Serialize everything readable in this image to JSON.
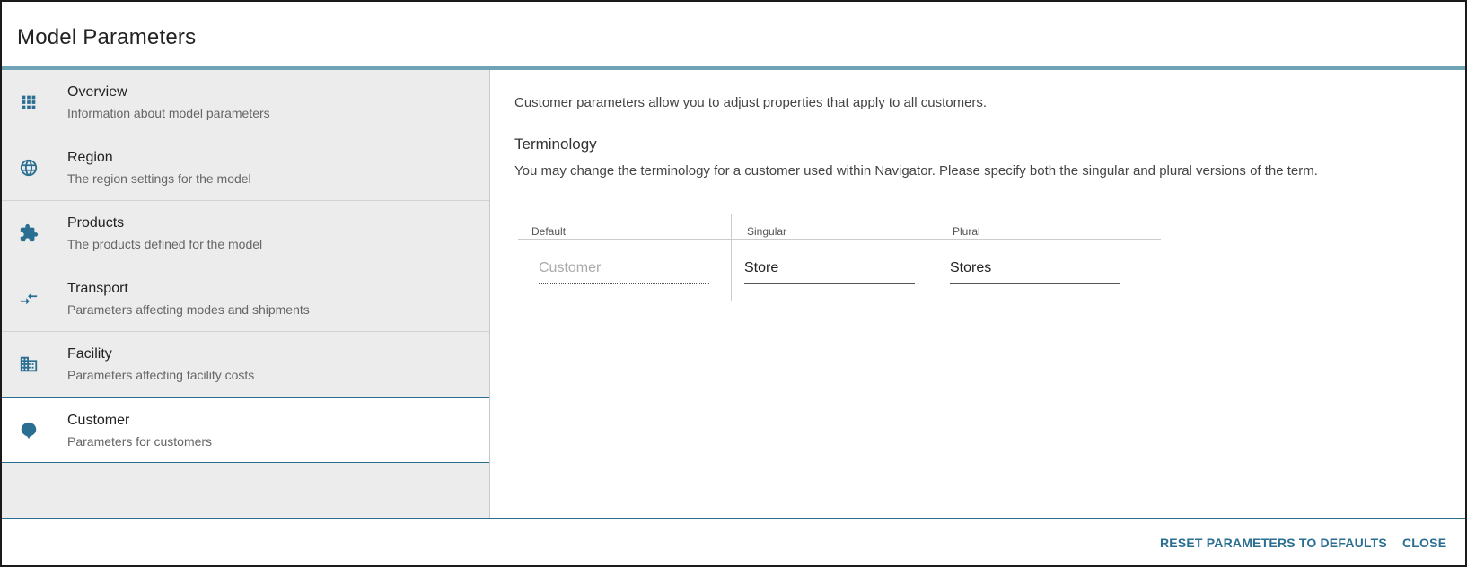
{
  "dialog": {
    "title": "Model Parameters"
  },
  "sidebar": {
    "items": [
      {
        "label": "Overview",
        "description": "Information about model parameters",
        "icon": "apps-grid-icon"
      },
      {
        "label": "Region",
        "description": "The region settings for the model",
        "icon": "globe-icon"
      },
      {
        "label": "Products",
        "description": "The products defined for the model",
        "icon": "puzzle-icon"
      },
      {
        "label": "Transport",
        "description": "Parameters affecting modes and shipments",
        "icon": "compare-arrows-icon"
      },
      {
        "label": "Facility",
        "description": "Parameters affecting facility costs",
        "icon": "building-icon"
      },
      {
        "label": "Customer",
        "description": "Parameters for customers",
        "icon": "location-pin-icon",
        "active": true
      }
    ]
  },
  "content": {
    "intro": "Customer parameters allow you to adjust properties that apply to all customers.",
    "section_title": "Terminology",
    "section_desc": "You may change the terminology for a customer used within Navigator. Please specify both the singular and plural versions of the term.",
    "table": {
      "headers": [
        "Default",
        "Singular",
        "Plural"
      ],
      "default_value": "Customer",
      "singular_value": "Store",
      "plural_value": "Stores"
    }
  },
  "footer": {
    "reset_label": "RESET PARAMETERS TO DEFAULTS",
    "close_label": "CLOSE"
  },
  "colors": {
    "accent": "#2a6f92",
    "header_rule": "#6fa3b6",
    "sidebar_bg": "#ececec"
  }
}
